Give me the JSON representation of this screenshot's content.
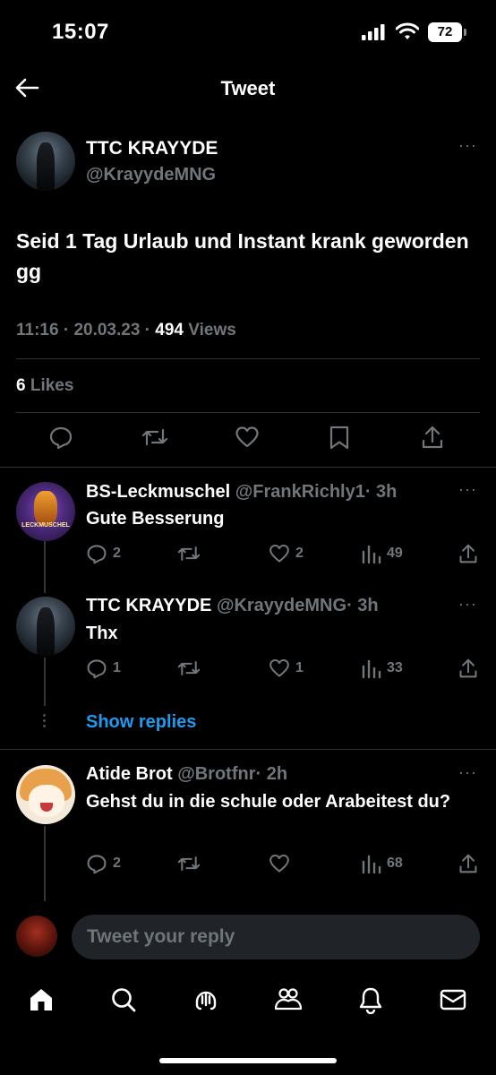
{
  "status": {
    "time": "15:07",
    "battery": "72"
  },
  "header": {
    "title": "Tweet"
  },
  "tweet": {
    "author_name": "TTC KRAYYDE",
    "author_handle": "@KrayydeMNG",
    "more": "···",
    "text": "Seid 1 Tag Urlaub und Instant krank geworden gg",
    "time": "11:16",
    "sep1": " · ",
    "date": "20.03.23",
    "sep2": " · ",
    "views_count": "494",
    "views_label": " Views",
    "likes_count": "6",
    "likes_label": " Likes"
  },
  "replies": [
    {
      "name": "BS-Leckmuschel",
      "handle": "@FrankRichly1",
      "time": "· 3h",
      "text": "Gute Besserung",
      "reply_count": "2",
      "like_count": "2",
      "view_count": "49",
      "avatar_text": "LECKMUSCHEL"
    },
    {
      "name": "TTC KRAYYDE",
      "handle": "@KrayydeMNG",
      "time": "· 3h",
      "text": "Thx",
      "reply_count": "1",
      "like_count": "1",
      "view_count": "33"
    },
    {
      "name": "Atide Brot",
      "handle": "@Brotfnr",
      "time": "· 2h",
      "text": "Gehst du in die schule oder Arabeitest du?",
      "reply_count": "2",
      "like_count": "",
      "view_count": "68"
    }
  ],
  "show_replies": "Show replies",
  "compose": {
    "placeholder": "Tweet your reply"
  },
  "tabs": [
    "home-icon",
    "search-icon",
    "spaces-icon",
    "communities-icon",
    "notifications-icon",
    "messages-icon"
  ],
  "colors": {
    "accent": "#1d9bf0",
    "muted": "#71767b",
    "background": "#000000",
    "divider": "#2f3336"
  }
}
